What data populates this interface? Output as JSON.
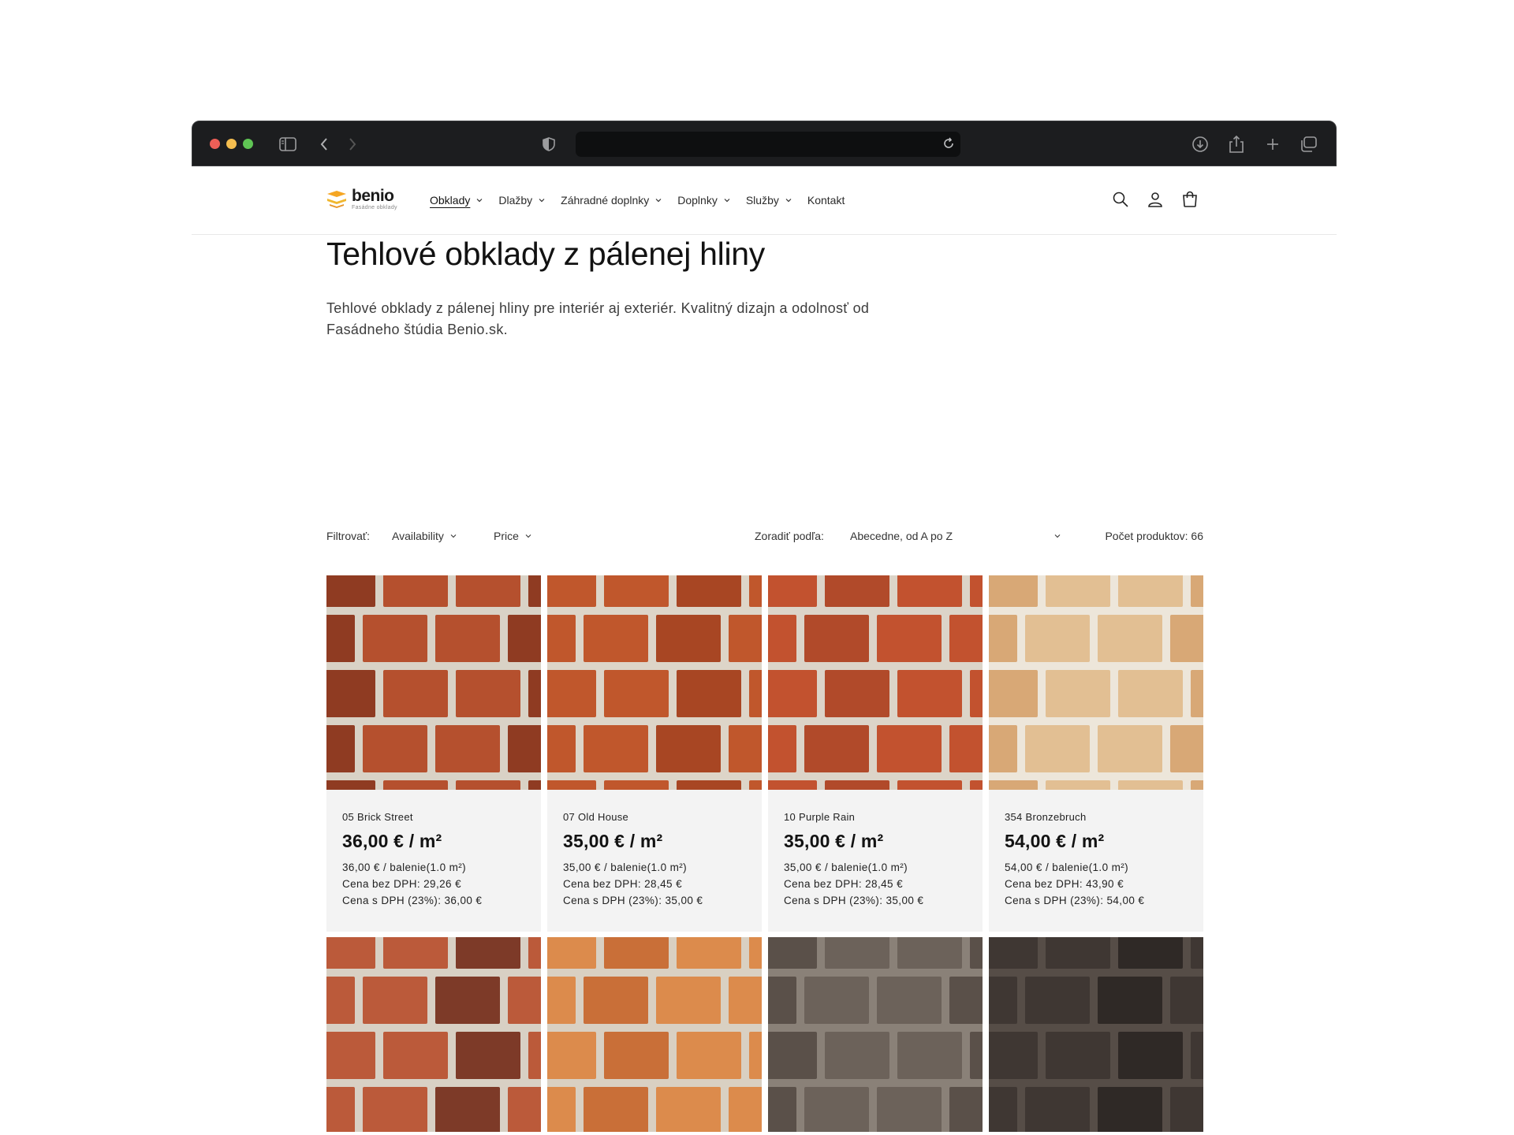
{
  "header": {
    "logo_name": "benio",
    "logo_sub": "Fasádne obklady",
    "nav": [
      {
        "label": "Obklady",
        "dropdown": true,
        "active": true
      },
      {
        "label": "Dlažby",
        "dropdown": true
      },
      {
        "label": "Záhradné doplnky",
        "dropdown": true
      },
      {
        "label": "Doplnky",
        "dropdown": true
      },
      {
        "label": "Služby",
        "dropdown": true
      },
      {
        "label": "Kontakt",
        "dropdown": false
      }
    ],
    "icons": [
      "search-icon",
      "account-icon",
      "cart-icon"
    ]
  },
  "page": {
    "title": "Tehlové obklady z pálenej hliny",
    "description": "Tehlové obklady z pálenej hliny pre interiér aj exteriér. Kvalitný dizajn a odolnosť od Fasádneho štúdia Benio.sk."
  },
  "filters": {
    "label": "Filtrovať:",
    "availability": "Availability",
    "price": "Price",
    "sort_label": "Zoradiť podľa:",
    "sort_value": "Abecedne, od A po Z",
    "count": "Počet produktov: 66"
  },
  "products": [
    {
      "name": "05 Brick Street",
      "price": "36,00 €  / m²",
      "pack": "36,00 € / balenie(1.0 m²)",
      "net": "Cena bez DPH: 29,26 €",
      "gross": "Cena s DPH (23%): 36,00 €",
      "brick": "#b5502e",
      "brick2": "#8f3b22",
      "mortar": "#d9d2c6"
    },
    {
      "name": "07 Old House",
      "price": "35,00 €  / m²",
      "pack": "35,00 € / balenie(1.0 m²)",
      "net": "Cena bez DPH: 28,45 €",
      "gross": "Cena s DPH (23%): 35,00 €",
      "brick": "#c0572c",
      "brick2": "#a84623",
      "mortar": "#ddd5c8"
    },
    {
      "name": "10 Purple Rain",
      "price": "35,00 €  / m²",
      "pack": "35,00 € / balenie(1.0 m²)",
      "net": "Cena bez DPH: 28,45 €",
      "gross": "Cena s DPH (23%): 35,00 €",
      "brick": "#c2522f",
      "brick2": "#b14a2a",
      "mortar": "#dcd4c8"
    },
    {
      "name": "354 Bronzebruch",
      "price": "54,00 €  / m²",
      "pack": "54,00 € / balenie(1.0 m²)",
      "net": "Cena bez DPH: 43,90 €",
      "gross": "Cena s DPH (23%): 54,00 €",
      "brick": "#e2bf93",
      "brick2": "#d8a876",
      "mortar": "#ede6da"
    },
    {
      "name": "",
      "price": "",
      "pack": "",
      "net": "",
      "gross": "",
      "brick": "#bb5a3a",
      "brick2": "#7d3a28",
      "mortar": "#d8d0c4"
    },
    {
      "name": "",
      "price": "",
      "pack": "",
      "net": "",
      "gross": "",
      "brick": "#dc8b4c",
      "brick2": "#c96f38",
      "mortar": "#d9d0c2"
    },
    {
      "name": "",
      "price": "",
      "pack": "",
      "net": "",
      "gross": "",
      "brick": "#6c625a",
      "brick2": "#5a5049",
      "mortar": "#8a8178"
    },
    {
      "name": "",
      "price": "",
      "pack": "",
      "net": "",
      "gross": "",
      "brick": "#3f3733",
      "brick2": "#2f2926",
      "mortar": "#564d47"
    }
  ]
}
